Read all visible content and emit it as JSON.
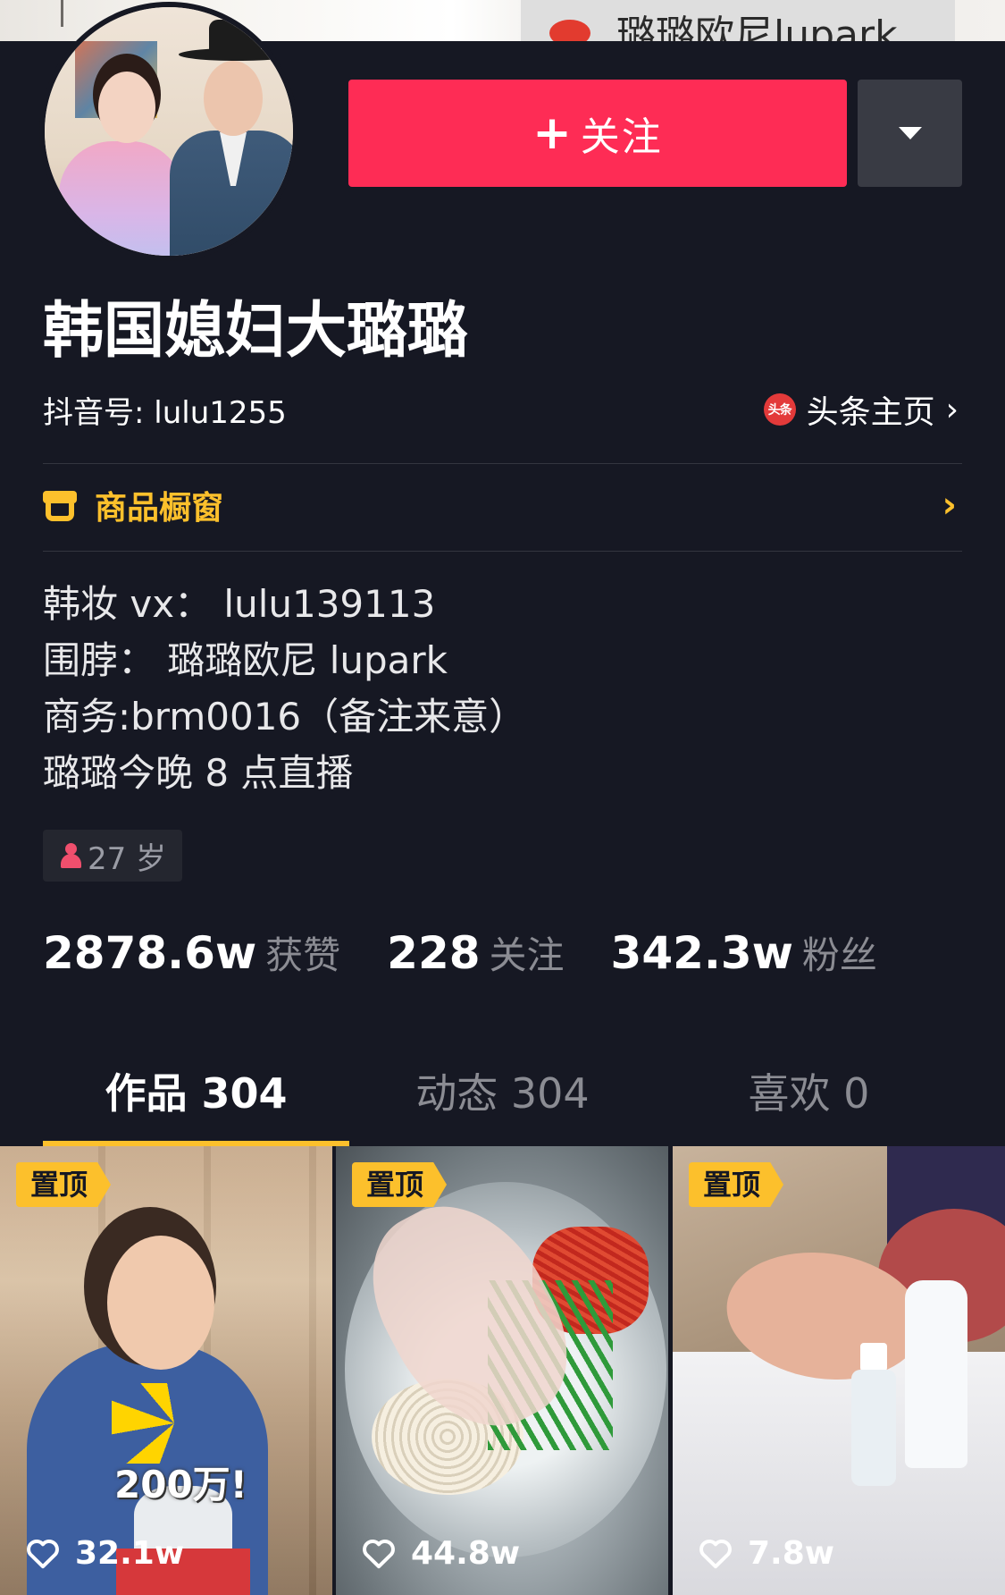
{
  "cover": {
    "banner_text": "璐璐欧尼lupark"
  },
  "profile": {
    "name": "韩国媳妇大璐璐",
    "douyin_id": "抖音号: lulu1255",
    "toutiao_link": "头条主页",
    "toutiao_icon_text": "头条"
  },
  "actions": {
    "follow_label": "关注",
    "follow_plus": "+",
    "follow_color": "#fe2c55",
    "more_icon": "triangle-down-icon"
  },
  "shop": {
    "label": "商品橱窗",
    "icon": "store-icon",
    "color": "#fcc02c"
  },
  "bio": {
    "lines": [
      "韩妆 vx：  lulu139113",
      "围脖：  璐璐欧尼 lupark",
      "商务:brm0016（备注来意）",
      "璐璐今晚 8 点直播"
    ]
  },
  "tags": {
    "age": "27 岁",
    "gender_icon": "female-icon"
  },
  "stats": {
    "likes_num": "2878.6w",
    "likes_label": "获赞",
    "following_num": "228",
    "following_label": "关注",
    "followers_num": "342.3w",
    "followers_label": "粉丝"
  },
  "tabs": {
    "works": "作品 304",
    "dynamics": "动态 304",
    "likes": "喜欢 0",
    "active": "works",
    "indicator_color": "#fcc02c"
  },
  "videos": [
    {
      "pin_label": "置顶",
      "likes": "32.1w",
      "overlay_text": "200万!"
    },
    {
      "pin_label": "置顶",
      "likes": "44.8w"
    },
    {
      "pin_label": "置顶",
      "likes": "7.8w"
    }
  ]
}
